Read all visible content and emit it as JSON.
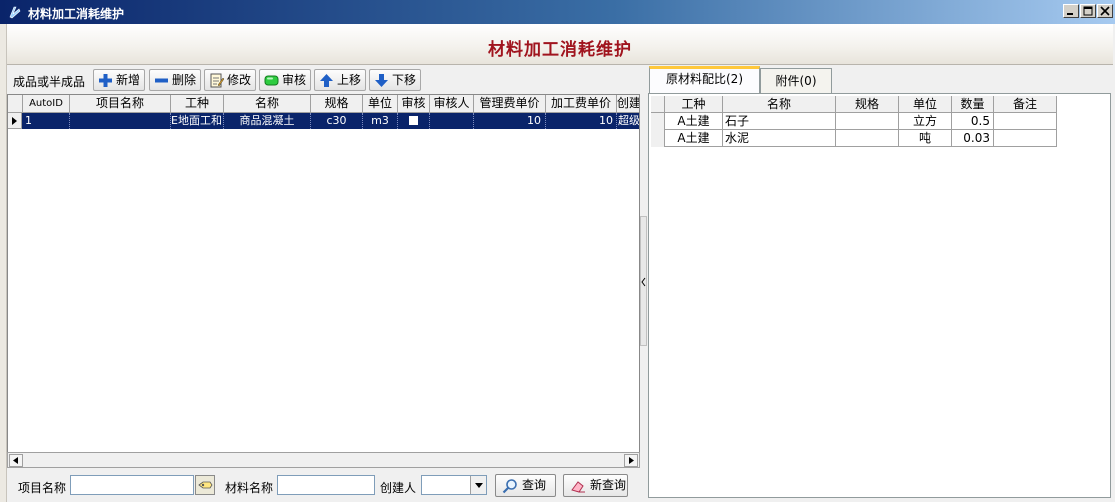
{
  "window": {
    "title": "材料加工消耗维护"
  },
  "header": {
    "title": "材料加工消耗维护"
  },
  "toolbar": {
    "label": "成品或半成品",
    "add": "新增",
    "delete": "删除",
    "edit": "修改",
    "review": "审核",
    "move_up": "上移",
    "move_down": "下移"
  },
  "main_grid": {
    "columns": [
      "AutoID",
      "项目名称",
      "工种",
      "名称",
      "规格",
      "单位",
      "审核",
      "审核人",
      "管理费单价",
      "加工费单价",
      "创建"
    ],
    "rows": [
      {
        "auto_id": "1",
        "project_name": "",
        "work_type": "E地面工和",
        "name": "商品混凝土",
        "spec": "c30",
        "unit": "m3",
        "reviewed": false,
        "reviewer": "",
        "mgmt_price": "10",
        "proc_price": "10",
        "creator": "超级"
      }
    ]
  },
  "search": {
    "project_label": "项目名称",
    "project_value": "",
    "material_label": "材料名称",
    "material_value": "",
    "creator_label": "创建人",
    "creator_value": "",
    "query_button": "查询",
    "new_query_button": "新查询"
  },
  "tabs": [
    {
      "label": "原材料配比(2)",
      "active": true
    },
    {
      "label": "附件(0)",
      "active": false
    }
  ],
  "material_grid": {
    "columns": [
      "工种",
      "名称",
      "规格",
      "单位",
      "数量",
      "备注"
    ],
    "rows": [
      {
        "work_type": "A土建",
        "name": "石子",
        "spec": "",
        "unit": "立方",
        "qty": "0.5",
        "note": ""
      },
      {
        "work_type": "A土建",
        "name": "水泥",
        "spec": "",
        "unit": "吨",
        "qty": "0.03",
        "note": ""
      }
    ]
  },
  "colors": {
    "title_red": "#a0141e",
    "selection": "#0a246a",
    "titlebar": "#0a246a"
  }
}
